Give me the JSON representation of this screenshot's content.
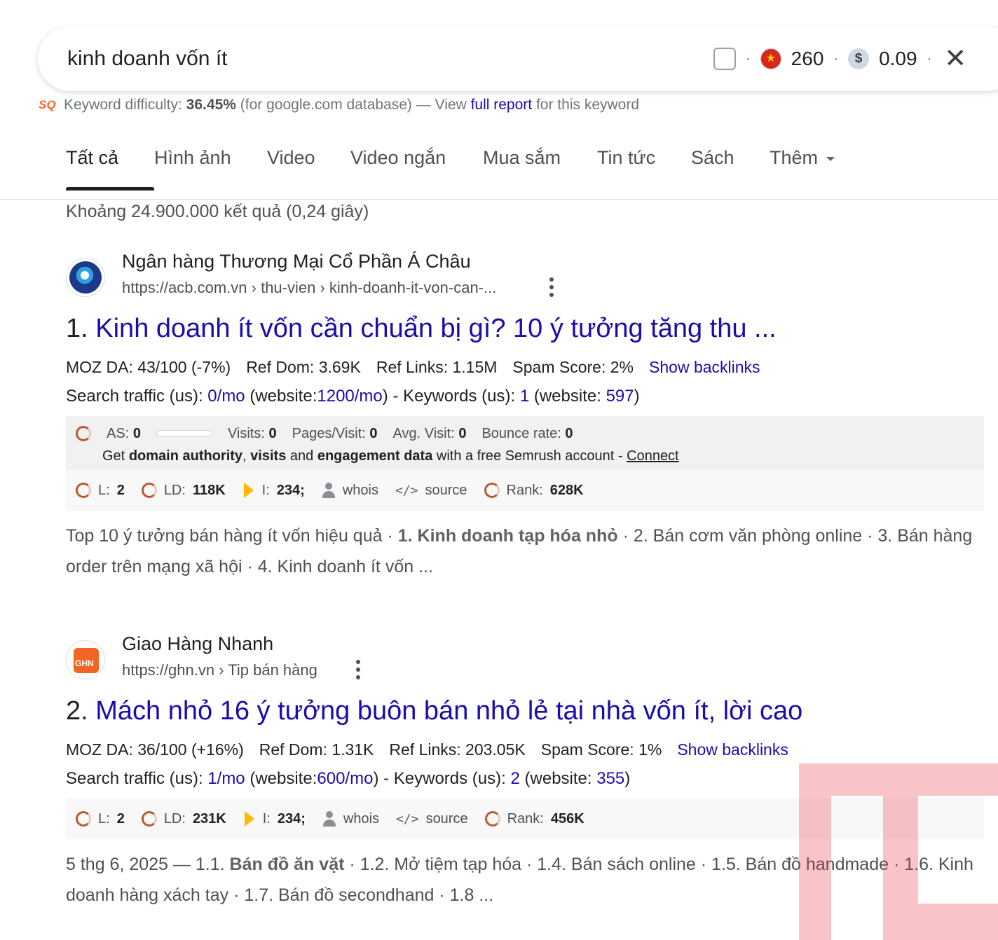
{
  "search": {
    "query": "kinh doanh vốn ít",
    "volume": "260",
    "cpc": "0.09",
    "dot": "·",
    "close_glyph": "✕",
    "dollar_glyph": "$"
  },
  "keyword_difficulty": {
    "logo": "SQ",
    "label": "Keyword difficulty:",
    "value": "36.45%",
    "middle": "(for google.com database) — View",
    "link": "full report",
    "suffix": "for this keyword"
  },
  "tabs": [
    {
      "label": "Tất cả",
      "active": true
    },
    {
      "label": "Hình ảnh"
    },
    {
      "label": "Video"
    },
    {
      "label": "Video ngắn"
    },
    {
      "label": "Mua sắm"
    },
    {
      "label": "Tin tức"
    },
    {
      "label": "Sách"
    },
    {
      "label": "Thêm"
    }
  ],
  "stats": "Khoảng 24.900.000 kết quả (0,24 giây)",
  "results": [
    {
      "site_name": "Ngân hàng Thương Mại Cổ Phần Á Châu",
      "url": "https://acb.com.vn › thu-vien › kinh-doanh-it-von-can-...",
      "number": "1.",
      "title": "Kinh doanh ít vốn cần chuẩn bị gì? 10 ý tưởng tăng thu ...",
      "moz_da": "MOZ DA: 43/100 (-7%)",
      "ref_dom": "Ref Dom: 3.69K",
      "ref_links": "Ref Links: 1.15M",
      "spam": "Spam Score: 2%",
      "backlinks": "Show backlinks",
      "traffic": {
        "t1": "Search traffic (us):",
        "v1": "0/mo",
        "t2": "(website:",
        "v2": "1200/mo",
        "t3": ") - Keywords (us):",
        "v3": "1",
        "t4": "(website:",
        "v4": "597",
        "t5": ")"
      },
      "semrush": {
        "as_label": "AS:",
        "as_value": "0",
        "visits_label": "Visits:",
        "visits_value": "0",
        "pages_label": "Pages/Visit:",
        "pages_value": "0",
        "avg_label": "Avg. Visit:",
        "avg_value": "0",
        "bounce_label": "Bounce rate:",
        "bounce_value": "0",
        "l2_a": "Get",
        "l2_b": "domain authority",
        "l2_c": ",",
        "l2_d": "visits",
        "l2_e": "and",
        "l2_f": "engagement data",
        "l2_g": "with a free Semrush account -",
        "l2_link": "Connect"
      },
      "metrics": {
        "l_label": "L:",
        "l_value": "2",
        "ld_label": "LD:",
        "ld_value": "118K",
        "i_label": "I:",
        "i_value": "234;",
        "whois": "whois",
        "code_glyph": "</>",
        "source": "source",
        "rank_label": "Rank:",
        "rank_value": "628K"
      },
      "snippet": {
        "a": "Top 10 ý tưởng bán hàng ít vốn hiệu quả ·",
        "b": "1. Kinh doanh tạp hóa nhỏ",
        "c": "· 2. Bán cơm văn phòng online · 3. Bán hàng order trên mạng xã hội · 4. Kinh doanh ít vốn ..."
      }
    },
    {
      "site_name": "Giao Hàng Nhanh",
      "url": "https://ghn.vn › Tip bán hàng",
      "number": "2.",
      "title": "Mách nhỏ 16 ý tưởng buôn bán nhỏ lẻ tại nhà vốn ít, lời cao",
      "moz_da": "MOZ DA: 36/100 (+16%)",
      "ref_dom": "Ref Dom: 1.31K",
      "ref_links": "Ref Links: 203.05K",
      "spam": "Spam Score: 1%",
      "backlinks": "Show backlinks",
      "traffic": {
        "t1": "Search traffic (us):",
        "v1": "1/mo",
        "t2": "(website:",
        "v2": "600/mo",
        "t3": ") - Keywords (us):",
        "v3": "2",
        "t4": "(website:",
        "v4": "355",
        "t5": ")"
      },
      "metrics": {
        "l_label": "L:",
        "l_value": "2",
        "ld_label": "LD:",
        "ld_value": "231K",
        "i_label": "I:",
        "i_value": "234;",
        "whois": "whois",
        "code_glyph": "</>",
        "source": "source",
        "rank_label": "Rank:",
        "rank_value": "456K"
      },
      "snippet": {
        "a": "5 thg 6, 2025 — 1.1.",
        "b": "Bán đồ ăn vặt",
        "c": "· 1.2. Mở tiệm tạp hóa · 1.4. Bán sách online · 1.5. Bán đồ handmade · 1.6. Kinh doanh hàng xách tay · 1.7. Bán đồ secondhand · 1.8 ..."
      }
    }
  ],
  "colors": {
    "link": "#1a0dab",
    "semrush_orange": "#ff642d",
    "watermark_red": "#e8303a"
  }
}
